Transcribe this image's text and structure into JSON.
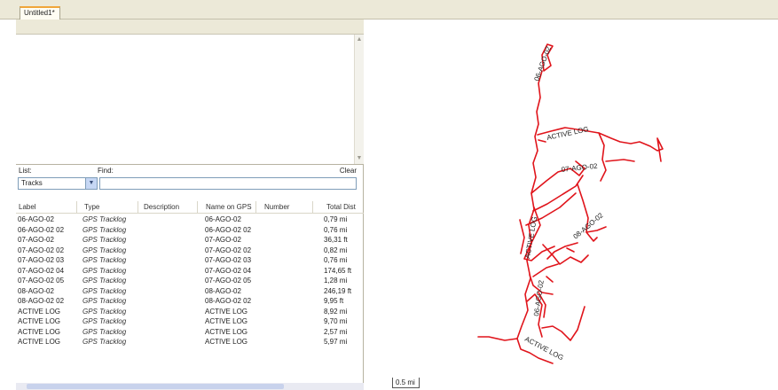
{
  "document_tab": {
    "label": "Untitled1*"
  },
  "list_panel": {
    "list_label": "List:",
    "list_value": "Tracks",
    "find_label": "Find:",
    "find_value": "",
    "clear_label": "Clear"
  },
  "table": {
    "columns": [
      "Label",
      "Type",
      "Description",
      "Name on GPS",
      "Number",
      "Total Dist"
    ],
    "rows": [
      {
        "label": "06-AGO-02",
        "type": "GPS Tracklog",
        "description": "",
        "name": "06-AGO-02",
        "number": "",
        "dist": "0,79 mi"
      },
      {
        "label": "06-AGO-02 02",
        "type": "GPS Tracklog",
        "description": "",
        "name": "06-AGO-02 02",
        "number": "",
        "dist": "0,76 mi"
      },
      {
        "label": "07-AGO-02",
        "type": "GPS Tracklog",
        "description": "",
        "name": "07-AGO-02",
        "number": "",
        "dist": "36,31 ft"
      },
      {
        "label": "07-AGO-02 02",
        "type": "GPS Tracklog",
        "description": "",
        "name": "07-AGO-02 02",
        "number": "",
        "dist": "0,82 mi"
      },
      {
        "label": "07-AGO-02 03",
        "type": "GPS Tracklog",
        "description": "",
        "name": "07-AGO-02 03",
        "number": "",
        "dist": "0,76 mi"
      },
      {
        "label": "07-AGO-02 04",
        "type": "GPS Tracklog",
        "description": "",
        "name": "07-AGO-02 04",
        "number": "",
        "dist": "174,65 ft"
      },
      {
        "label": "07-AGO-02 05",
        "type": "GPS Tracklog",
        "description": "",
        "name": "07-AGO-02 05",
        "number": "",
        "dist": "1,28 mi"
      },
      {
        "label": "08-AGO-02",
        "type": "GPS Tracklog",
        "description": "",
        "name": "08-AGO-02",
        "number": "",
        "dist": "246,19 ft"
      },
      {
        "label": "08-AGO-02 02",
        "type": "GPS Tracklog",
        "description": "",
        "name": "08-AGO-02 02",
        "number": "",
        "dist": "9,95 ft"
      },
      {
        "label": "ACTIVE LOG",
        "type": "GPS Tracklog",
        "description": "",
        "name": "ACTIVE LOG",
        "number": "",
        "dist": "8,92 mi"
      },
      {
        "label": "ACTIVE LOG",
        "type": "GPS Tracklog",
        "description": "",
        "name": "ACTIVE LOG",
        "number": "",
        "dist": "9,70 mi"
      },
      {
        "label": "ACTIVE LOG",
        "type": "GPS Tracklog",
        "description": "",
        "name": "ACTIVE LOG",
        "number": "",
        "dist": "2,57 mi"
      },
      {
        "label": "ACTIVE LOG",
        "type": "GPS Tracklog",
        "description": "",
        "name": "ACTIVE LOG",
        "number": "",
        "dist": "5,97 mi"
      }
    ]
  },
  "map": {
    "track_color": "#e0141b",
    "scale_label": "0.5 mi",
    "labels": {
      "top": "06-AGO-02",
      "upper": "ACTIVE LOG",
      "middle": "07-AGO-02",
      "left": "ACTIVE LOG",
      "right": "08-AGO-02",
      "lower": "06-AGO-02",
      "bottom": "ACTIVE LOG"
    }
  }
}
